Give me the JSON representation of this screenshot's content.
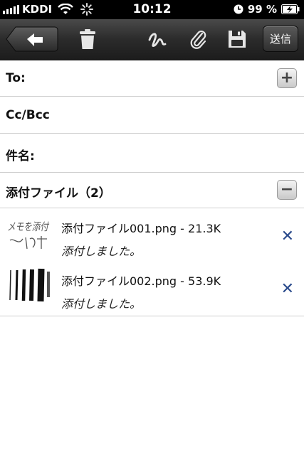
{
  "status_bar": {
    "carrier": "KDDI",
    "time": "10:12",
    "battery": "99 %"
  },
  "toolbar": {
    "back_icon": "back-arrow-icon",
    "trash_icon": "trash-icon",
    "draw_icon": "squiggle-icon",
    "attach_icon": "paperclip-icon",
    "save_icon": "floppy-disk-icon",
    "send_label": "送信"
  },
  "compose": {
    "to_label": "To:",
    "ccbcc_label": "Cc/Bcc",
    "subject_label": "件名:",
    "add_button": "+",
    "attachments_label": "添付ファイル（2）",
    "collapse_button": "−"
  },
  "attachments": [
    {
      "name": "添付ファイル001.png - 21.3K",
      "status": "添付しました。",
      "thumb_text": "メモを添付"
    },
    {
      "name": "添付ファイル002.png - 53.9K",
      "status": "添付しました。"
    }
  ],
  "delete_label": "✕"
}
